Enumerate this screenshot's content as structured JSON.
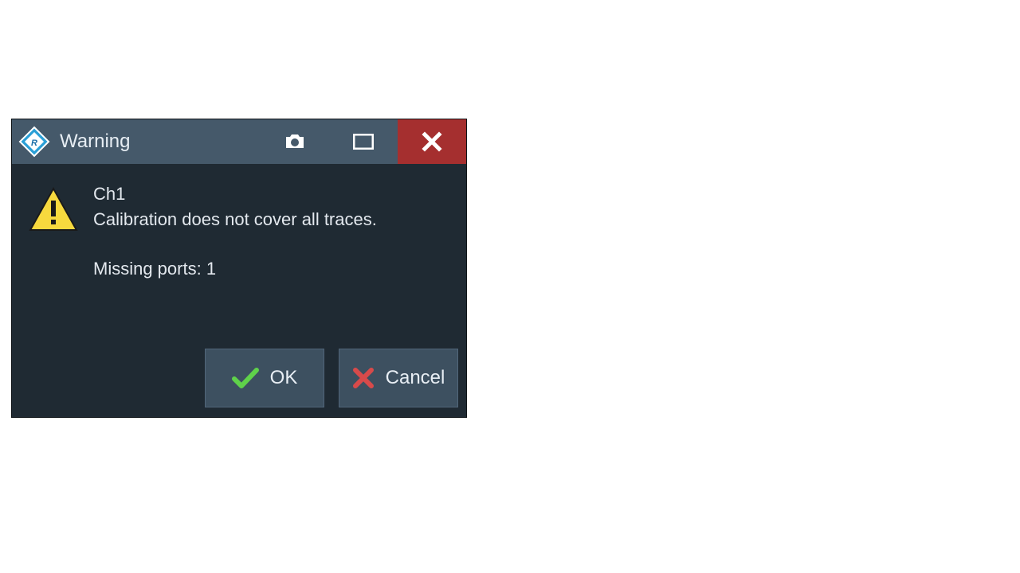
{
  "dialog": {
    "title": "Warning",
    "message": {
      "channel": "Ch1",
      "line1": "Calibration does not cover all traces.",
      "line2": "Missing ports: 1"
    },
    "buttons": {
      "ok": "OK",
      "cancel": "Cancel"
    }
  },
  "colors": {
    "titlebar": "#45596a",
    "close": "#a52f2f",
    "body": "#1f2a33",
    "button": "#3d5060",
    "ok_check": "#5fd24a",
    "cancel_x": "#d84a4a",
    "warn_fill": "#f7d93e"
  }
}
